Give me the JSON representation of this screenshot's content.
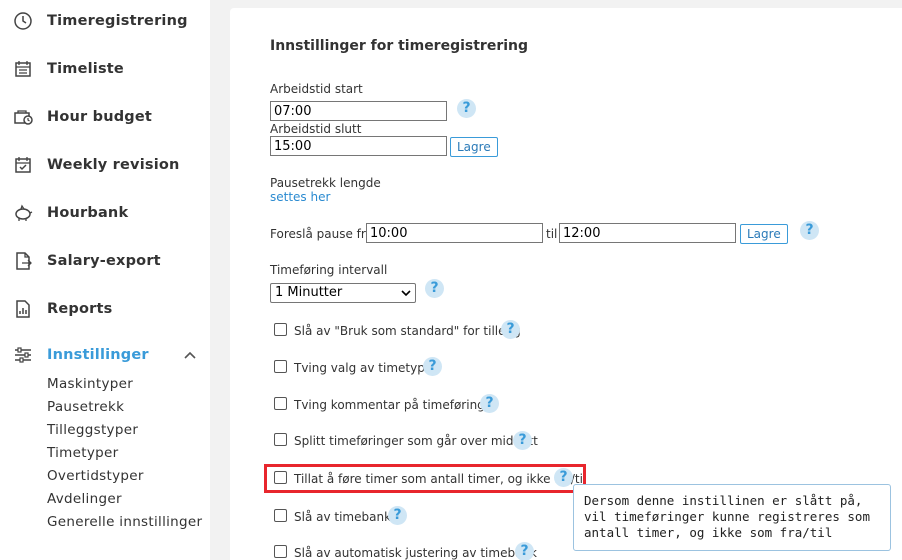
{
  "sidebar": {
    "items": [
      {
        "label": "Timeregistrering",
        "icon": "clock-icon"
      },
      {
        "label": "Timeliste",
        "icon": "calendar-icon"
      },
      {
        "label": "Hour budget",
        "icon": "money-icon"
      },
      {
        "label": "Weekly revision",
        "icon": "calendar-check-icon"
      },
      {
        "label": "Hourbank",
        "icon": "piggy-bank-icon"
      },
      {
        "label": "Salary-export",
        "icon": "export-file-icon"
      },
      {
        "label": "Reports",
        "icon": "report-icon"
      },
      {
        "label": "Innstillinger",
        "icon": "sliders-icon"
      }
    ],
    "sub_items": [
      "Maskintyper",
      "Pausetrekk",
      "Tilleggstyper",
      "Timetyper",
      "Overtidstyper",
      "Avdelinger",
      "Generelle innstillinger"
    ],
    "active_color": "#3a9bd9"
  },
  "main": {
    "title": "Innstillinger for timeregistrering",
    "work_start_label": "Arbeidstid start",
    "work_start_value": "07:00",
    "work_end_label": "Arbeidstid slutt",
    "work_end_value": "15:00",
    "save_label": "Lagre",
    "pause_length_label": "Pausetrekk lengde",
    "pause_length_link": "settes her",
    "suggest_pause_label": "Foreslå pause fra",
    "suggest_pause_from": "10:00",
    "suggest_pause_to_label": "til",
    "suggest_pause_to": "12:00",
    "interval_label": "Timeføring intervall",
    "interval_value": "1 Minutter",
    "help_glyph": "?",
    "checkboxes": [
      {
        "label": "Slå av \"Bruk som standard\" for tillegg",
        "checked": false
      },
      {
        "label": "Tving valg av timetype",
        "checked": false
      },
      {
        "label": "Tving kommentar på timeføringer",
        "checked": false
      },
      {
        "label": "Splitt timeføringer som går over midnatt",
        "checked": false
      },
      {
        "label": "Tillat å føre timer som antall timer, og ikke fra/til",
        "checked": false
      },
      {
        "label": "Slå av timebank",
        "checked": false
      },
      {
        "label": "Slå av automatisk justering av timebank",
        "checked": false
      }
    ],
    "tooltip": "Dersom denne instillinen er slått på, vil timeføringer kunne registreres som antall timer, og ikke som fra/til"
  },
  "colors": {
    "accent": "#3a9bd9",
    "highlight": "#e8262d"
  }
}
